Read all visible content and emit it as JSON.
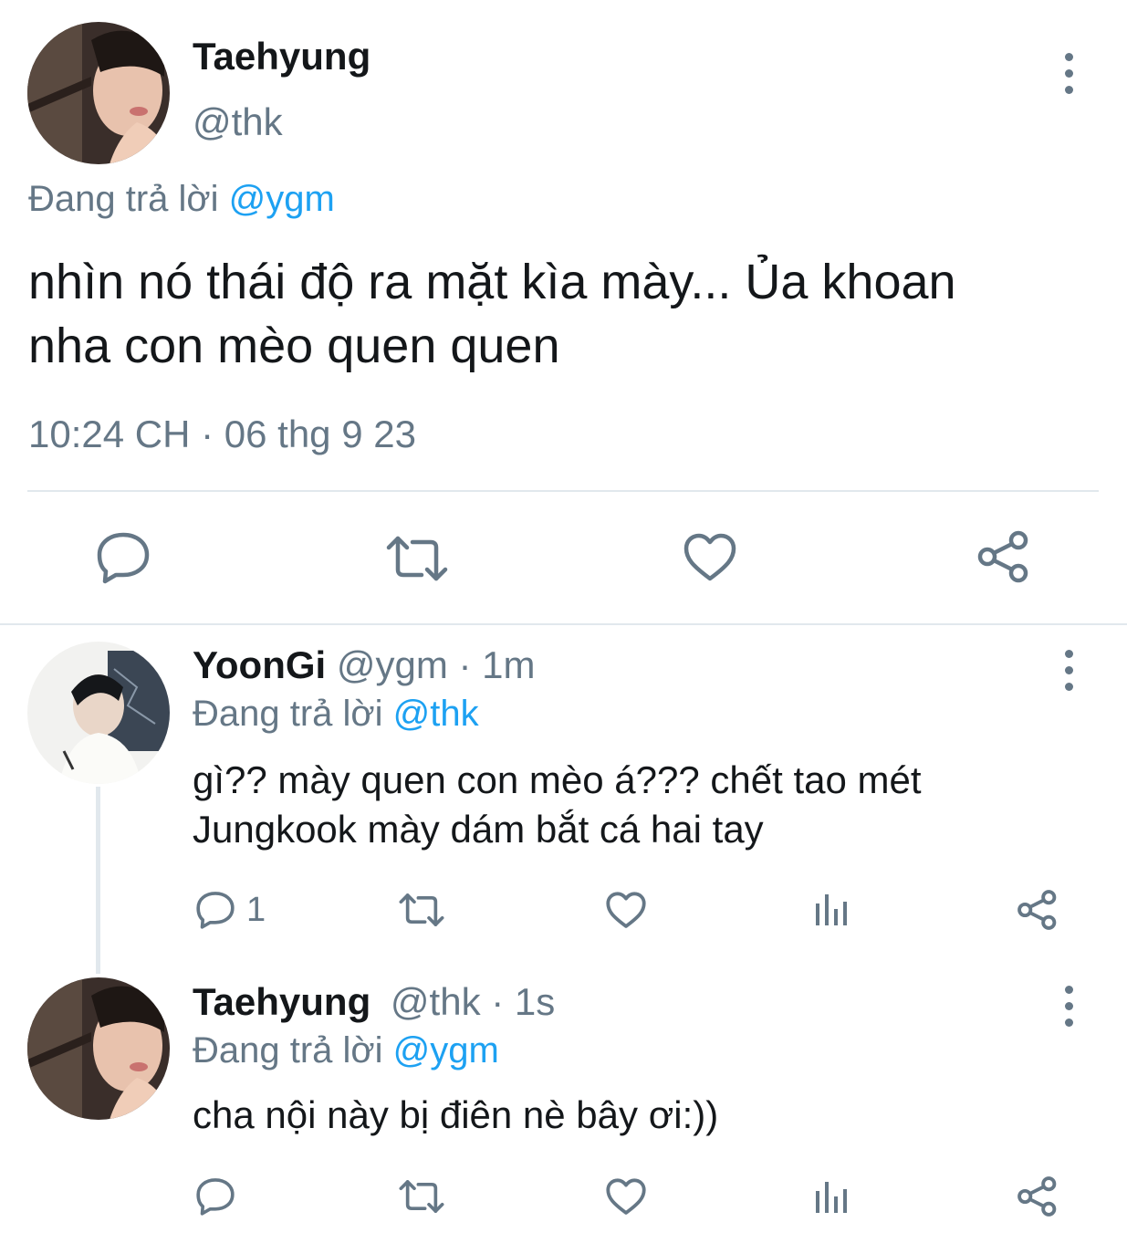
{
  "main_tweet": {
    "name": "Taehyung",
    "handle": "@thk",
    "replying_prefix": "Đang trả lời",
    "replying_to": "@ygm",
    "text_line1": "nhìn nó thái độ ra mặt kìa mày... Ủa khoan",
    "text_line2": "nha con mèo quen quen",
    "timestamp": "10:24 CH · 06 thg 9 23"
  },
  "reply1": {
    "name": "YoonGi",
    "handle": "@ygm",
    "time": " · 1m",
    "replying_prefix": "Đang trả lời",
    "replying_to": "@thk",
    "text_line1": "gì?? mày quen con mèo á??? chết tao mét",
    "text_line2": "Jungkook mày dám bắt cá hai tay",
    "reply_count": "1"
  },
  "reply2": {
    "name": "Taehyung",
    "handle": "@thk",
    "time": " · 1s",
    "replying_prefix": "Đang trả lời",
    "replying_to": "@ygm",
    "text": "cha nội này bị điên nè bây ơi:))"
  },
  "icons": [
    "reply-icon",
    "retweet-icon",
    "like-icon",
    "share-icon",
    "analytics-icon",
    "more-icon"
  ],
  "colors": {
    "text": "#14171a",
    "muted": "#657786",
    "link": "#1da1f2",
    "divider": "#e1e8ed"
  }
}
